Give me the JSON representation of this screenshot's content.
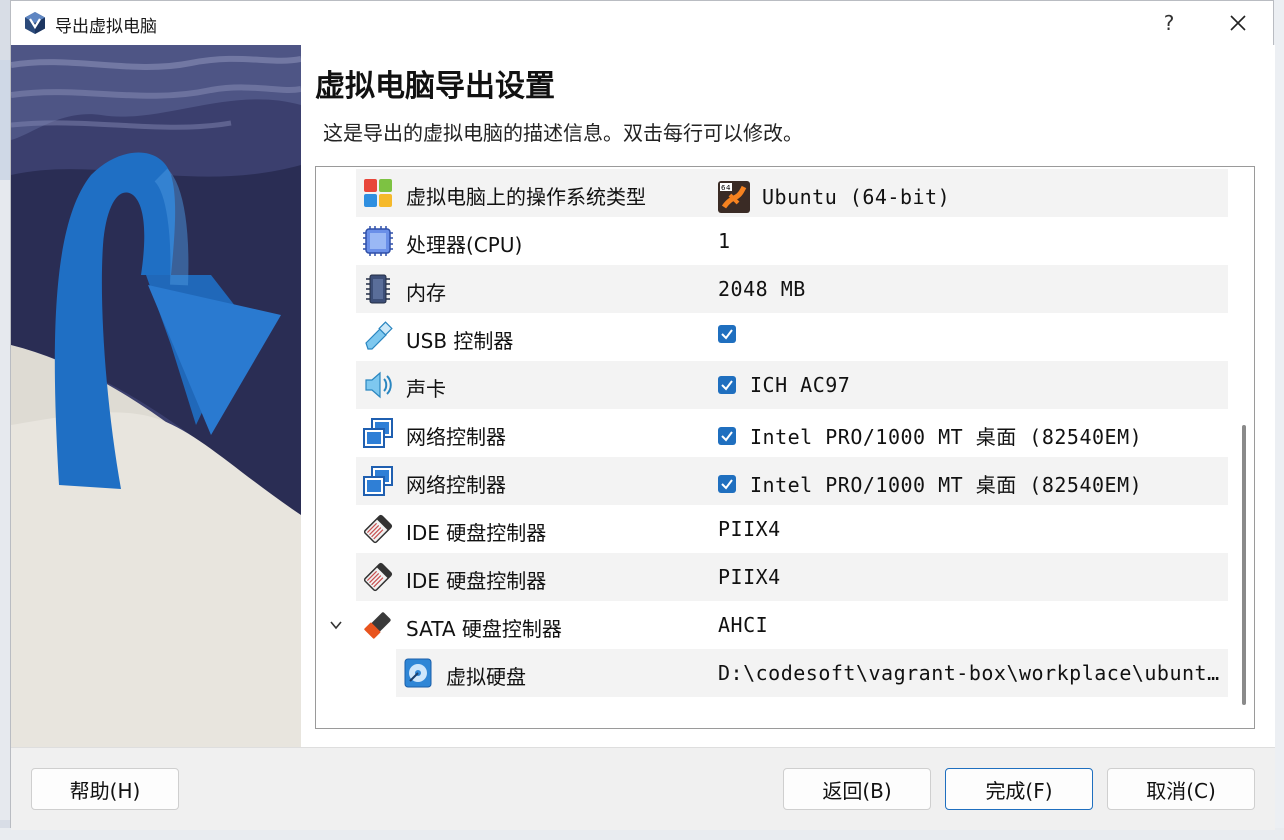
{
  "window": {
    "title": "导出虚拟电脑",
    "help_glyph": "?"
  },
  "page": {
    "title": "虚拟电脑导出设置",
    "description": "这是导出的虚拟电脑的描述信息。双击每行可以修改。"
  },
  "rows": [
    {
      "label": "虚拟电脑上的操作系统类型",
      "value": "Ubuntu (64-bit)",
      "icon": "os-type-icon"
    },
    {
      "label": "处理器(CPU)",
      "value": "1",
      "icon": "cpu-icon"
    },
    {
      "label": "内存",
      "value": "2048 MB",
      "icon": "memory-icon"
    },
    {
      "label": "USB 控制器",
      "value": "",
      "checked": true,
      "icon": "usb-icon"
    },
    {
      "label": "声卡",
      "value": "ICH AC97",
      "checked": true,
      "icon": "sound-icon"
    },
    {
      "label": "网络控制器",
      "value": "Intel PRO/1000 MT 桌面 (82540EM)",
      "checked": true,
      "icon": "network-icon"
    },
    {
      "label": "网络控制器",
      "value": "Intel PRO/1000 MT 桌面 (82540EM)",
      "checked": true,
      "icon": "network-icon"
    },
    {
      "label": "IDE 硬盘控制器",
      "value": "PIIX4",
      "icon": "ide-controller-icon"
    },
    {
      "label": "IDE 硬盘控制器",
      "value": "PIIX4",
      "icon": "ide-controller-icon"
    },
    {
      "label": "SATA 硬盘控制器",
      "value": "AHCI",
      "icon": "sata-controller-icon"
    },
    {
      "label": "虚拟硬盘",
      "value": "D:\\codesoft\\vagrant-box\\workplace\\ubunt…",
      "icon": "virtual-disk-icon"
    }
  ],
  "buttons": {
    "help": "帮助(H)",
    "back": "返回(B)",
    "finish": "完成(F)",
    "cancel": "取消(C)"
  },
  "colors": {
    "accent": "#1f6fbf",
    "checkbox": "#1f6fbf",
    "side_image_bg": "#3a3f6c"
  }
}
